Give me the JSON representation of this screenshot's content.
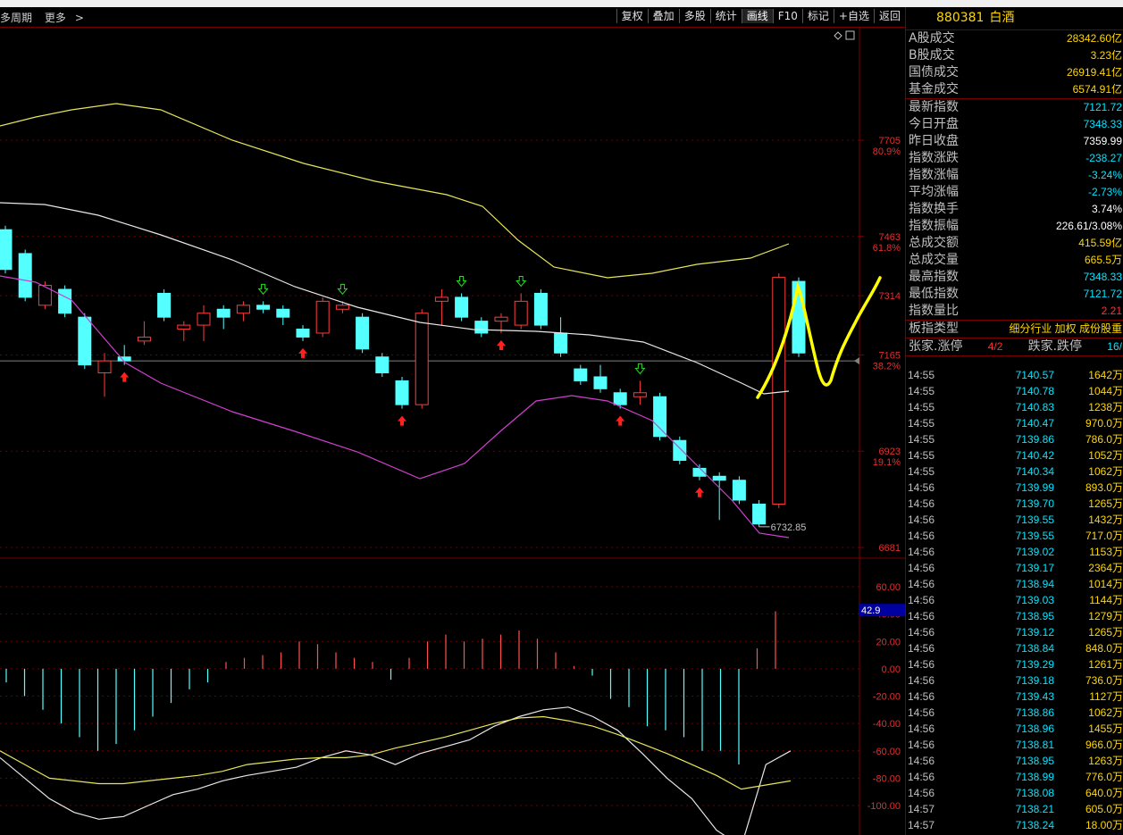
{
  "toolbar": {
    "left_items": [
      "多周期",
      "更多"
    ],
    "buttons": [
      "复权",
      "叠加",
      "多股",
      "统计",
      "画线",
      "F10",
      "标记",
      "+自选",
      "返回"
    ],
    "active": "画线"
  },
  "quote": {
    "code": "880381",
    "name": "白酒",
    "rows1": [
      {
        "label": "A股成交",
        "value": "28342.60亿",
        "color": "#ffd700"
      },
      {
        "label": "B股成交",
        "value": "3.23亿",
        "color": "#ffd700"
      },
      {
        "label": "国债成交",
        "value": "26919.41亿",
        "color": "#ffd700"
      },
      {
        "label": "基金成交",
        "value": "6574.91亿",
        "color": "#ffd700"
      }
    ],
    "rows2": [
      {
        "label": "最新指数",
        "value": "7121.72",
        "color": "#00e5ff"
      },
      {
        "label": "今日开盘",
        "value": "7348.33",
        "color": "#00e5ff"
      },
      {
        "label": "昨日收盘",
        "value": "7359.99",
        "color": "#ffffff"
      },
      {
        "label": "指数涨跌",
        "value": "-238.27",
        "color": "#00e5ff"
      },
      {
        "label": "指数涨幅",
        "value": "-3.24%",
        "color": "#00e5ff"
      },
      {
        "label": "平均涨幅",
        "value": "-2.73%",
        "color": "#00e5ff"
      },
      {
        "label": "指数换手",
        "value": "3.74%",
        "color": "#ffffff"
      },
      {
        "label": "指数振幅",
        "value": "226.61/3.08%",
        "color": "#ffffff"
      },
      {
        "label": "总成交额",
        "value": "415.59亿",
        "color": "#ffd700"
      },
      {
        "label": "总成交量",
        "value": "665.5万",
        "color": "#ffd700"
      },
      {
        "label": "最高指数",
        "value": "7348.33",
        "color": "#00e5ff"
      },
      {
        "label": "最低指数",
        "value": "7121.72",
        "color": "#00e5ff"
      },
      {
        "label": "指数量比",
        "value": "2.21",
        "color": "#ff3030"
      }
    ],
    "type_row": {
      "label": "板指类型",
      "value": "细分行业 加权 成份股重"
    },
    "updown_row": {
      "label": "张家.涨停",
      "value1": "4/2",
      "label2": "跌家.跌停",
      "value2": "16/"
    }
  },
  "ticks": [
    {
      "time": "14:55",
      "price": "7140.57",
      "vol": "1642万"
    },
    {
      "time": "14:55",
      "price": "7140.78",
      "vol": "1044万"
    },
    {
      "time": "14:55",
      "price": "7140.83",
      "vol": "1238万"
    },
    {
      "time": "14:55",
      "price": "7140.47",
      "vol": "970.0万"
    },
    {
      "time": "14:55",
      "price": "7139.86",
      "vol": "786.0万"
    },
    {
      "time": "14:55",
      "price": "7140.42",
      "vol": "1052万"
    },
    {
      "time": "14:55",
      "price": "7140.34",
      "vol": "1062万"
    },
    {
      "time": "14:56",
      "price": "7139.99",
      "vol": "893.0万"
    },
    {
      "time": "14:56",
      "price": "7139.70",
      "vol": "1265万"
    },
    {
      "time": "14:56",
      "price": "7139.55",
      "vol": "1432万"
    },
    {
      "time": "14:56",
      "price": "7139.55",
      "vol": "717.0万"
    },
    {
      "time": "14:56",
      "price": "7139.02",
      "vol": "1153万"
    },
    {
      "time": "14:56",
      "price": "7139.17",
      "vol": "2364万"
    },
    {
      "time": "14:56",
      "price": "7138.94",
      "vol": "1014万"
    },
    {
      "time": "14:56",
      "price": "7139.03",
      "vol": "1144万"
    },
    {
      "time": "14:56",
      "price": "7138.95",
      "vol": "1279万"
    },
    {
      "time": "14:56",
      "price": "7139.12",
      "vol": "1265万"
    },
    {
      "time": "14:56",
      "price": "7138.84",
      "vol": "848.0万"
    },
    {
      "time": "14:56",
      "price": "7139.29",
      "vol": "1261万"
    },
    {
      "time": "14:56",
      "price": "7139.18",
      "vol": "736.0万"
    },
    {
      "time": "14:56",
      "price": "7139.43",
      "vol": "1127万"
    },
    {
      "time": "14:56",
      "price": "7138.86",
      "vol": "1062万"
    },
    {
      "time": "14:56",
      "price": "7138.96",
      "vol": "1455万"
    },
    {
      "time": "14:56",
      "price": "7138.81",
      "vol": "966.0万"
    },
    {
      "time": "14:56",
      "price": "7138.95",
      "vol": "1263万"
    },
    {
      "time": "14:56",
      "price": "7138.99",
      "vol": "776.0万"
    },
    {
      "time": "14:56",
      "price": "7138.08",
      "vol": "640.0万"
    },
    {
      "time": "14:57",
      "price": "7138.21",
      "vol": "605.0万"
    },
    {
      "time": "14:57",
      "price": "7138.24",
      "vol": "18.00万"
    }
  ],
  "chart_data": {
    "type": "candlestick",
    "price_axis": [
      {
        "value": 7705,
        "fib": "80.9%"
      },
      {
        "value": 7463,
        "fib": "61.8%"
      },
      {
        "value": 7314,
        "fib": ""
      },
      {
        "value": 7165,
        "fib": "38.2%"
      },
      {
        "value": 6923,
        "fib": "19.1%"
      },
      {
        "value": 6681,
        "fib": ""
      }
    ],
    "low_label": "6732.85",
    "candles": [
      {
        "o": 7480,
        "c": 7380,
        "h": 7490,
        "l": 7370
      },
      {
        "o": 7420,
        "c": 7310,
        "h": 7430,
        "l": 7300
      },
      {
        "o": 7290,
        "c": 7340,
        "h": 7350,
        "l": 7280
      },
      {
        "o": 7330,
        "c": 7270,
        "h": 7340,
        "l": 7260
      },
      {
        "o": 7260,
        "c": 7140,
        "h": 7270,
        "l": 7130
      },
      {
        "o": 7120,
        "c": 7150,
        "h": 7170,
        "l": 7060
      },
      {
        "o": 7160,
        "c": 7150,
        "h": 7190,
        "l": 7140
      },
      {
        "o": 7200,
        "c": 7210,
        "h": 7250,
        "l": 7190
      },
      {
        "o": 7320,
        "c": 7260,
        "h": 7330,
        "l": 7250
      },
      {
        "o": 7230,
        "c": 7240,
        "h": 7250,
        "l": 7200
      },
      {
        "o": 7240,
        "c": 7270,
        "h": 7290,
        "l": 7200
      },
      {
        "o": 7280,
        "c": 7260,
        "h": 7290,
        "l": 7230
      },
      {
        "o": 7270,
        "c": 7290,
        "h": 7300,
        "l": 7250
      },
      {
        "o": 7290,
        "c": 7280,
        "h": 7300,
        "l": 7270
      },
      {
        "o": 7280,
        "c": 7260,
        "h": 7290,
        "l": 7240
      },
      {
        "o": 7230,
        "c": 7210,
        "h": 7240,
        "l": 7200
      },
      {
        "o": 7220,
        "c": 7300,
        "h": 7310,
        "l": 7210
      },
      {
        "o": 7280,
        "c": 7290,
        "h": 7300,
        "l": 7270
      },
      {
        "o": 7260,
        "c": 7180,
        "h": 7270,
        "l": 7170
      },
      {
        "o": 7160,
        "c": 7120,
        "h": 7170,
        "l": 7110
      },
      {
        "o": 7100,
        "c": 7040,
        "h": 7110,
        "l": 7030
      },
      {
        "o": 7040,
        "c": 7270,
        "h": 7280,
        "l": 7030
      },
      {
        "o": 7300,
        "c": 7310,
        "h": 7330,
        "l": 7240
      },
      {
        "o": 7310,
        "c": 7260,
        "h": 7320,
        "l": 7250
      },
      {
        "o": 7250,
        "c": 7220,
        "h": 7260,
        "l": 7210
      },
      {
        "o": 7250,
        "c": 7260,
        "h": 7270,
        "l": 7220
      },
      {
        "o": 7240,
        "c": 7300,
        "h": 7320,
        "l": 7230
      },
      {
        "o": 7320,
        "c": 7240,
        "h": 7330,
        "l": 7230
      },
      {
        "o": 7220,
        "c": 7170,
        "h": 7260,
        "l": 7160
      },
      {
        "o": 7130,
        "c": 7100,
        "h": 7140,
        "l": 7090
      },
      {
        "o": 7110,
        "c": 7080,
        "h": 7140,
        "l": 7070
      },
      {
        "o": 7070,
        "c": 7040,
        "h": 7080,
        "l": 7030
      },
      {
        "o": 7060,
        "c": 7070,
        "h": 7100,
        "l": 7040
      },
      {
        "o": 7060,
        "c": 6960,
        "h": 7070,
        "l": 6950
      },
      {
        "o": 6950,
        "c": 6900,
        "h": 6960,
        "l": 6890
      },
      {
        "o": 6880,
        "c": 6860,
        "h": 6890,
        "l": 6850
      },
      {
        "o": 6860,
        "c": 6850,
        "h": 6870,
        "l": 6750
      },
      {
        "o": 6850,
        "c": 6800,
        "h": 6860,
        "l": 6790
      },
      {
        "o": 6790,
        "c": 6740,
        "h": 6800,
        "l": 6733
      },
      {
        "o": 6790,
        "c": 7360,
        "h": 7370,
        "l": 6780
      },
      {
        "o": 7350,
        "c": 7170,
        "h": 7360,
        "l": 7160
      }
    ],
    "arrows": [
      {
        "i": 6,
        "dir": "up"
      },
      {
        "i": 13,
        "dir": "down"
      },
      {
        "i": 15,
        "dir": "up"
      },
      {
        "i": 17,
        "dir": "down"
      },
      {
        "i": 20,
        "dir": "up"
      },
      {
        "i": 23,
        "dir": "down"
      },
      {
        "i": 25,
        "dir": "up"
      },
      {
        "i": 26,
        "dir": "down"
      },
      {
        "i": 31,
        "dir": "up"
      },
      {
        "i": 32,
        "dir": "down"
      },
      {
        "i": 35,
        "dir": "up"
      }
    ],
    "indicator_axis": [
      60,
      40,
      20,
      0,
      -20,
      -40,
      -60,
      -80,
      -100
    ],
    "indicator_current": "42.9",
    "osc": [
      -10,
      -20,
      -30,
      -40,
      -50,
      -60,
      -55,
      -45,
      -35,
      -25,
      -15,
      -10,
      5,
      8,
      10,
      12,
      20,
      18,
      12,
      8,
      5,
      -8,
      8,
      20,
      25,
      20,
      22,
      25,
      28,
      22,
      12,
      2,
      -5,
      -22,
      -28,
      -42,
      -45,
      -50,
      -60,
      -60,
      -70,
      15,
      42
    ],
    "line_white": [
      -65,
      -80,
      -95,
      -105,
      -110,
      -108,
      -100,
      -92,
      -88,
      -82,
      -78,
      -75,
      -72,
      -65,
      -60,
      -63,
      -70,
      -62,
      -57,
      -52,
      -42,
      -35,
      -30,
      -28,
      -35,
      -45,
      -62,
      -80,
      -95,
      -118,
      -130,
      -70,
      -60
    ],
    "line_yellow": [
      -60,
      -70,
      -80,
      -82,
      -84,
      -84,
      -82,
      -80,
      -78,
      -75,
      -70,
      -68,
      -66,
      -65,
      -65,
      -63,
      -58,
      -54,
      -50,
      -45,
      -40,
      -36,
      -35,
      -38,
      -42,
      -48,
      -55,
      -62,
      -70,
      -78,
      -88,
      -85,
      -82
    ]
  }
}
